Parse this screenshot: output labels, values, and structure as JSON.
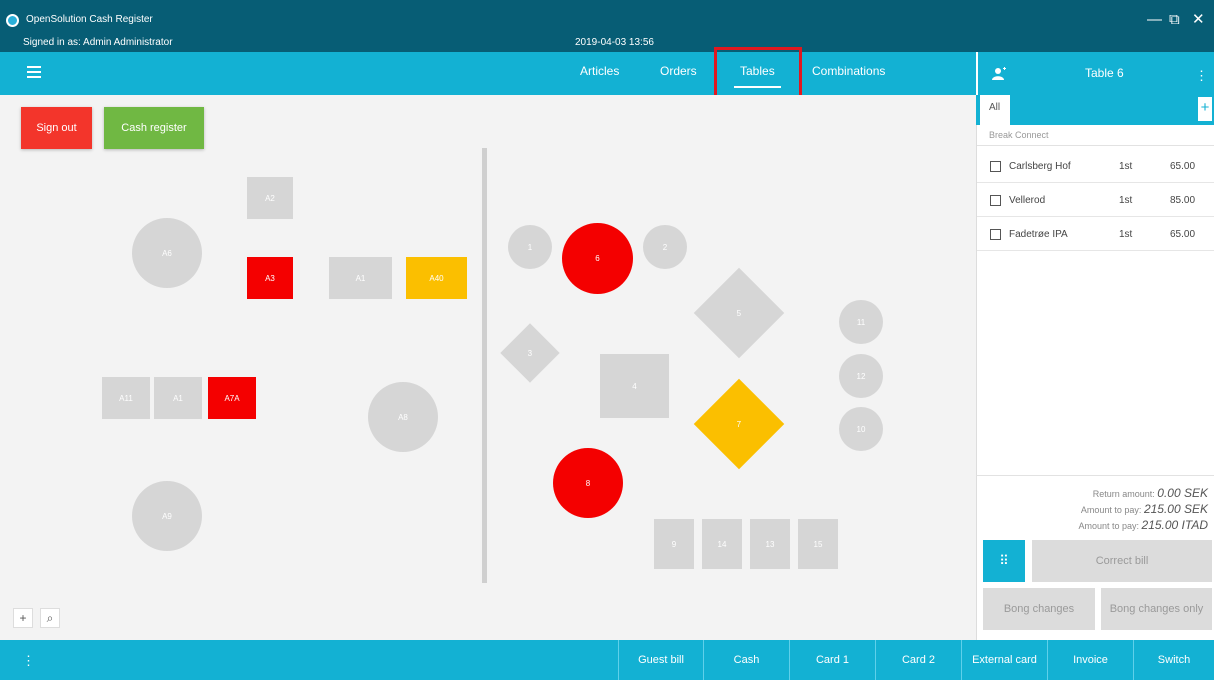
{
  "window": {
    "title": "OpenSolution Cash Register",
    "signed_in": "Signed in as: Admin Administrator",
    "datetime": "2019-04-03 13:56",
    "controls": {
      "minimize": "—",
      "restore": "⧉",
      "close": "✕"
    }
  },
  "nav": {
    "tabs": [
      {
        "label": "Articles",
        "active": false
      },
      {
        "label": "Orders",
        "active": false
      },
      {
        "label": "Tables",
        "active": true
      },
      {
        "label": "Combinations",
        "active": false
      }
    ]
  },
  "floor": {
    "sign_out_label": "Sign out",
    "cash_register_label": "Cash register",
    "colors": {
      "free": "#d6d6d6",
      "occupied": "#f40000",
      "reserved": "#fbbf00",
      "sign_out": "#f3352b",
      "cash_register": "#70b843"
    },
    "tables": [
      {
        "label": "A2",
        "shape": "square",
        "status": "free"
      },
      {
        "label": "A6",
        "shape": "circle",
        "status": "free"
      },
      {
        "label": "A3",
        "shape": "square",
        "status": "occupied"
      },
      {
        "label": "A1",
        "shape": "square",
        "status": "free"
      },
      {
        "label": "A40",
        "shape": "square",
        "status": "reserved"
      },
      {
        "label": "A11",
        "shape": "square",
        "status": "free"
      },
      {
        "label": "A1",
        "shape": "square",
        "status": "free"
      },
      {
        "label": "A7A",
        "shape": "square",
        "status": "occupied"
      },
      {
        "label": "A8",
        "shape": "circle",
        "status": "free"
      },
      {
        "label": "A9",
        "shape": "circle",
        "status": "free"
      },
      {
        "label": "1",
        "shape": "circle",
        "status": "free"
      },
      {
        "label": "6",
        "shape": "circle",
        "status": "occupied"
      },
      {
        "label": "2",
        "shape": "circle",
        "status": "free"
      },
      {
        "label": "5",
        "shape": "diamond",
        "status": "free"
      },
      {
        "label": "11",
        "shape": "circle",
        "status": "free"
      },
      {
        "label": "3",
        "shape": "diamond",
        "status": "free"
      },
      {
        "label": "4",
        "shape": "square",
        "status": "free"
      },
      {
        "label": "12",
        "shape": "circle",
        "status": "free"
      },
      {
        "label": "7",
        "shape": "diamond",
        "status": "reserved"
      },
      {
        "label": "10",
        "shape": "circle",
        "status": "free"
      },
      {
        "label": "8",
        "shape": "circle",
        "status": "occupied"
      },
      {
        "label": "9",
        "shape": "square",
        "status": "free"
      },
      {
        "label": "14",
        "shape": "square",
        "status": "free"
      },
      {
        "label": "13",
        "shape": "square",
        "status": "free"
      },
      {
        "label": "15",
        "shape": "square",
        "status": "free"
      }
    ],
    "tools": {
      "add_icon": "+",
      "search_icon": "⌕"
    }
  },
  "order_panel": {
    "table_label": "Table 6",
    "tab_all": "All",
    "add_tab": "+",
    "subheader": "Break   Connect",
    "items": [
      {
        "name": "Carlsberg Hof",
        "qty": "1st",
        "price": "65.00"
      },
      {
        "name": "Vellerod",
        "qty": "1st",
        "price": "85.00"
      },
      {
        "name": "Fadetrøe IPA",
        "qty": "1st",
        "price": "65.00"
      }
    ],
    "totals": [
      {
        "label": "Return amount:",
        "value": "0.00 SEK"
      },
      {
        "label": "Amount to pay:",
        "value": "215.00 SEK"
      },
      {
        "label": "Amount to pay:",
        "value": "215.00 ITAD"
      }
    ],
    "numpad_icon": "⠿",
    "correct_bill_label": "Correct bill",
    "bong_changes_label": "Bong changes",
    "bong_changes_only_label": "Bong changes only",
    "kebab_icon": "⋮"
  },
  "bottom_bar": {
    "kebab_icon": "⋮",
    "buttons": [
      "Guest bill",
      "Cash",
      "Card 1",
      "Card 2",
      "External card",
      "Invoice",
      "Switch"
    ]
  }
}
